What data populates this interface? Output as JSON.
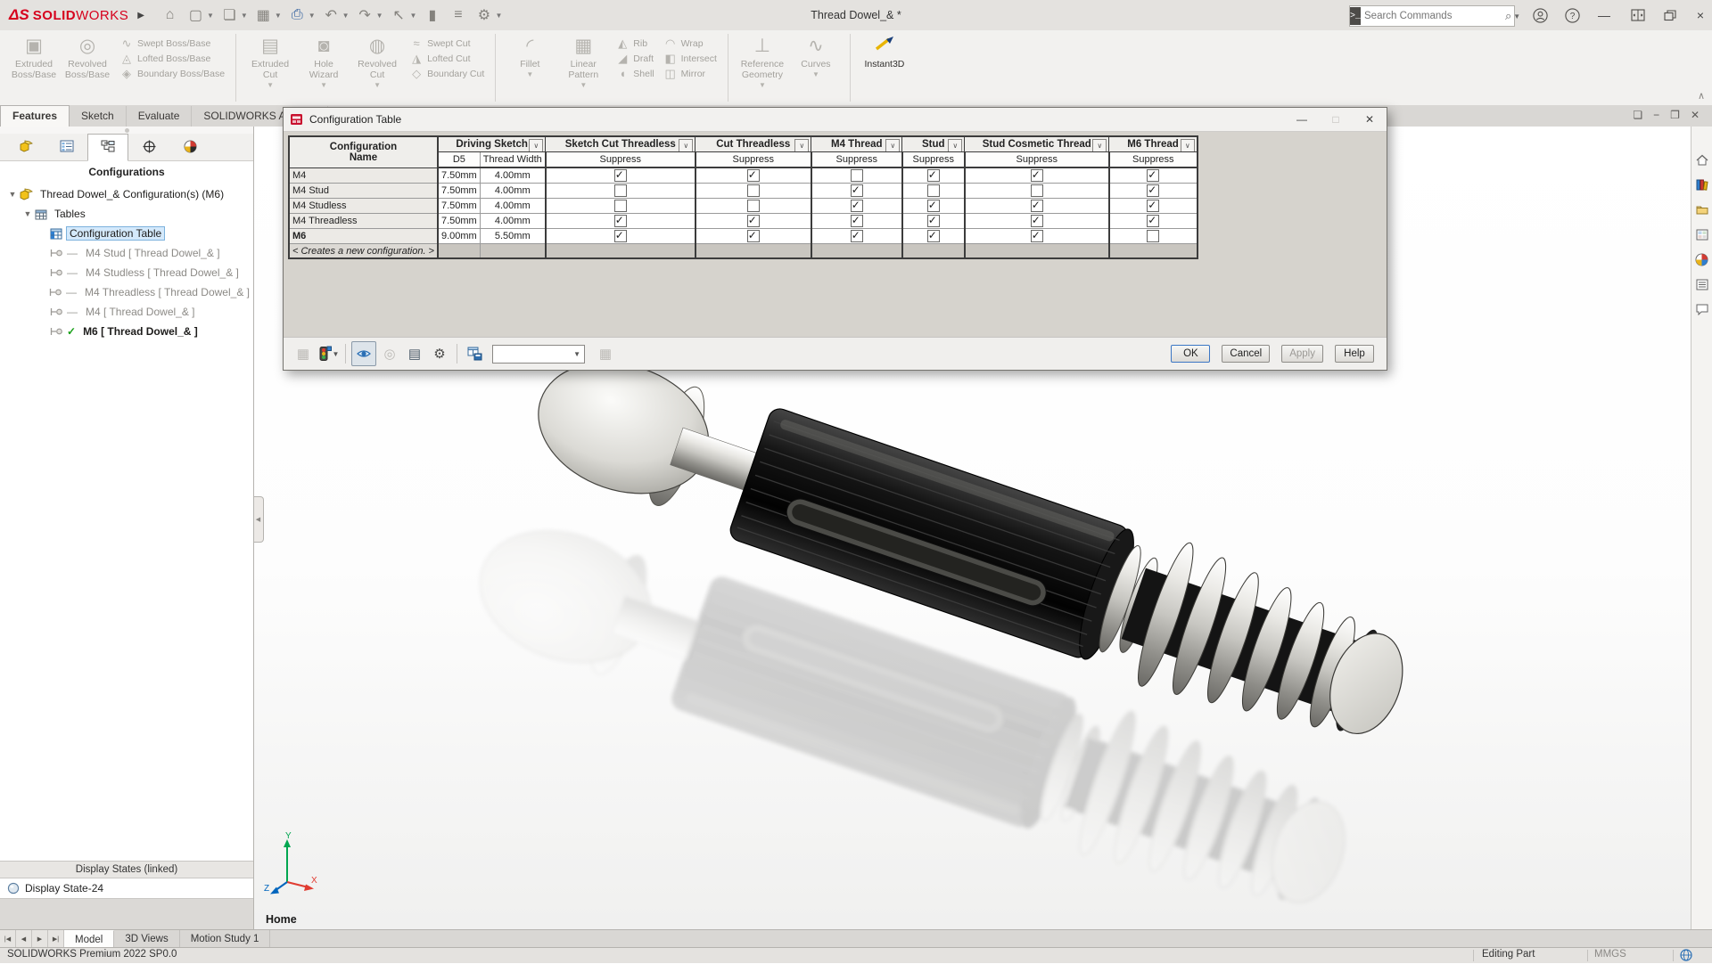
{
  "window": {
    "logo_mark": "ΔS",
    "logo_text_bold": "SOLID",
    "logo_text_light": "WORKS",
    "document_title": "Thread Dowel_& *",
    "search_placeholder": "Search Commands",
    "quick_icons": [
      "home",
      "new-document",
      "open-document",
      "save",
      "print",
      "undo",
      "redo",
      "select-cursor",
      "touch-mode",
      "command-list",
      "options-gear"
    ],
    "right_icons": [
      "user-account",
      "help",
      "minimize-window",
      "span-displays",
      "restore-window",
      "close-window"
    ]
  },
  "ribbon": {
    "tabs": [
      {
        "label": "Features",
        "active": true
      },
      {
        "label": "Sketch",
        "active": false
      },
      {
        "label": "Evaluate",
        "active": false
      },
      {
        "label": "SOLIDWORKS Add-Ins",
        "active": false
      }
    ],
    "groups": [
      {
        "items": [
          {
            "kind": "big",
            "lines": [
              "Extruded",
              "Boss/Base"
            ],
            "icon": "extruded-boss"
          },
          {
            "kind": "big",
            "lines": [
              "Revolved",
              "Boss/Base"
            ],
            "icon": "revolved-boss"
          },
          {
            "kind": "stack",
            "items": [
              {
                "label": "Swept Boss/Base",
                "icon": "swept-boss"
              },
              {
                "label": "Lofted Boss/Base",
                "icon": "lofted-boss"
              },
              {
                "label": "Boundary Boss/Base",
                "icon": "boundary-boss"
              }
            ]
          }
        ]
      },
      {
        "items": [
          {
            "kind": "big",
            "lines": [
              "Extruded",
              "Cut"
            ],
            "icon": "extruded-cut",
            "dropdown": true
          },
          {
            "kind": "big",
            "lines": [
              "Hole",
              "Wizard"
            ],
            "icon": "hole-wizard",
            "dropdown": true
          },
          {
            "kind": "big",
            "lines": [
              "Revolved",
              "Cut"
            ],
            "icon": "revolved-cut",
            "dropdown": true
          },
          {
            "kind": "stack",
            "items": [
              {
                "label": "Swept Cut",
                "icon": "swept-cut"
              },
              {
                "label": "Lofted Cut",
                "icon": "lofted-cut"
              },
              {
                "label": "Boundary Cut",
                "icon": "boundary-cut"
              }
            ]
          }
        ]
      },
      {
        "items": [
          {
            "kind": "big",
            "lines": [
              "Fillet",
              ""
            ],
            "icon": "fillet",
            "dropdown": true
          },
          {
            "kind": "big",
            "lines": [
              "Linear",
              "Pattern"
            ],
            "icon": "linear-pattern",
            "dropdown": true
          },
          {
            "kind": "stack",
            "items": [
              {
                "label": "Rib",
                "icon": "rib"
              },
              {
                "label": "Draft",
                "icon": "draft"
              },
              {
                "label": "Shell",
                "icon": "shell"
              }
            ]
          },
          {
            "kind": "stack",
            "items": [
              {
                "label": "Wrap",
                "icon": "wrap"
              },
              {
                "label": "Intersect",
                "icon": "intersect"
              },
              {
                "label": "Mirror",
                "icon": "mirror"
              }
            ]
          }
        ]
      },
      {
        "items": [
          {
            "kind": "big",
            "lines": [
              "Reference",
              "Geometry"
            ],
            "icon": "reference-geometry",
            "dropdown": true
          },
          {
            "kind": "big",
            "lines": [
              "Curves",
              ""
            ],
            "icon": "curves",
            "dropdown": true
          }
        ]
      },
      {
        "items": [
          {
            "kind": "big",
            "lines": [
              "Instant3D",
              ""
            ],
            "icon": "instant3d",
            "enabled": true
          }
        ]
      }
    ]
  },
  "sidebar": {
    "tab_icons": [
      "featuremanager-tree",
      "propertymanager",
      "configurationmanager",
      "dimxpertmanager",
      "displaymanager"
    ],
    "active_tab_index": 2,
    "header": "Configurations",
    "tree": [
      {
        "label": "Thread Dowel_& Configuration(s)  (M6)",
        "icon": "part",
        "level": 0,
        "caret": true
      },
      {
        "label": "Tables",
        "icon": "tables",
        "level": 1,
        "caret": true
      },
      {
        "label": "Configuration Table",
        "icon": "ctable",
        "level": 2,
        "selected": true
      },
      {
        "label": "M4 Stud [ Thread Dowel_& ]",
        "icon": "configuration",
        "level": 2,
        "inactive": true
      },
      {
        "label": "M4 Studless [ Thread Dowel_& ]",
        "icon": "configuration",
        "level": 2,
        "inactive": true
      },
      {
        "label": "M4 Threadless [ Thread Dowel_& ]",
        "icon": "configuration",
        "level": 2,
        "inactive": true
      },
      {
        "label": "M4 [ Thread Dowel_& ]",
        "icon": "configuration",
        "level": 2,
        "inactive": true
      },
      {
        "label": "M6 [ Thread Dowel_& ]",
        "icon": "configuration",
        "level": 2,
        "active_config": true
      }
    ],
    "display_states_header": "Display States (linked)",
    "display_state": "Display State-24"
  },
  "dialog": {
    "title": "Configuration Table",
    "table": {
      "corner_header_lines": [
        "Configuration",
        "Name"
      ],
      "column_groups": [
        {
          "label": "Driving Sketch",
          "sub": [
            "D5",
            "Thread Width"
          ]
        },
        {
          "label": "Sketch Cut Threadless",
          "sub": [
            "Suppress"
          ]
        },
        {
          "label": "Cut Threadless",
          "sub": [
            "Suppress"
          ]
        },
        {
          "label": "M4 Thread",
          "sub": [
            "Suppress"
          ]
        },
        {
          "label": "Stud",
          "sub": [
            "Suppress"
          ]
        },
        {
          "label": "Stud Cosmetic Thread",
          "sub": [
            "Suppress"
          ]
        },
        {
          "label": "M6 Thread",
          "sub": [
            "Suppress"
          ]
        }
      ],
      "rows": [
        {
          "name": "M4",
          "d5": "7.50mm",
          "thread_width": "4.00mm",
          "suppress": [
            true,
            true,
            false,
            true,
            true,
            true
          ]
        },
        {
          "name": "M4 Stud",
          "d5": "7.50mm",
          "thread_width": "4.00mm",
          "suppress": [
            false,
            false,
            true,
            false,
            false,
            true
          ]
        },
        {
          "name": "M4 Studless",
          "d5": "7.50mm",
          "thread_width": "4.00mm",
          "suppress": [
            false,
            false,
            true,
            true,
            true,
            true
          ]
        },
        {
          "name": "M4 Threadless",
          "d5": "7.50mm",
          "thread_width": "4.00mm",
          "suppress": [
            true,
            true,
            true,
            true,
            true,
            true
          ]
        },
        {
          "name": "M6",
          "bold": true,
          "d5": "9.00mm",
          "thread_width": "5.50mm",
          "suppress": [
            true,
            true,
            true,
            true,
            true,
            false
          ]
        }
      ],
      "new_row_label": "< Creates a new configuration. >"
    },
    "toolbar_icons": [
      "apply-config-table",
      "suppression-traffic-light",
      "separator",
      "preview",
      "linked-update",
      "table-properties",
      "table-settings-gear",
      "separator",
      "save-table-view",
      "value-combo",
      "export-table"
    ],
    "combo_value": "",
    "buttons": [
      {
        "label": "OK",
        "default": true
      },
      {
        "label": "Cancel"
      },
      {
        "label": "Apply",
        "disabled": true
      },
      {
        "label": "Help"
      }
    ]
  },
  "viewport": {
    "view_label": "Home",
    "triad": {
      "x": "X",
      "y": "Y",
      "z": "Z"
    },
    "window_controls": [
      "previous-window",
      "minimize-viewport",
      "restore-viewport",
      "close-viewport"
    ]
  },
  "taskpane_icons": [
    "solidworks-resources-home",
    "design-library",
    "file-explorer",
    "view-palette",
    "appearances-scenes",
    "custom-properties",
    "forum"
  ],
  "bottom": {
    "nav_icons": [
      "first-tab",
      "previous-tab",
      "next-tab",
      "last-tab"
    ],
    "tabs": [
      {
        "label": "Model",
        "active": true
      },
      {
        "label": "3D Views",
        "active": false
      },
      {
        "label": "Motion Study 1",
        "active": false
      }
    ]
  },
  "statusbar": {
    "left": "SOLIDWORKS Premium 2022 SP0.0",
    "mode": "Editing Part",
    "units": "MMGS"
  },
  "colors": {
    "brand_red": "#d6001c",
    "selection_blue": "#d4e9fb",
    "check_green": "#18a018"
  }
}
